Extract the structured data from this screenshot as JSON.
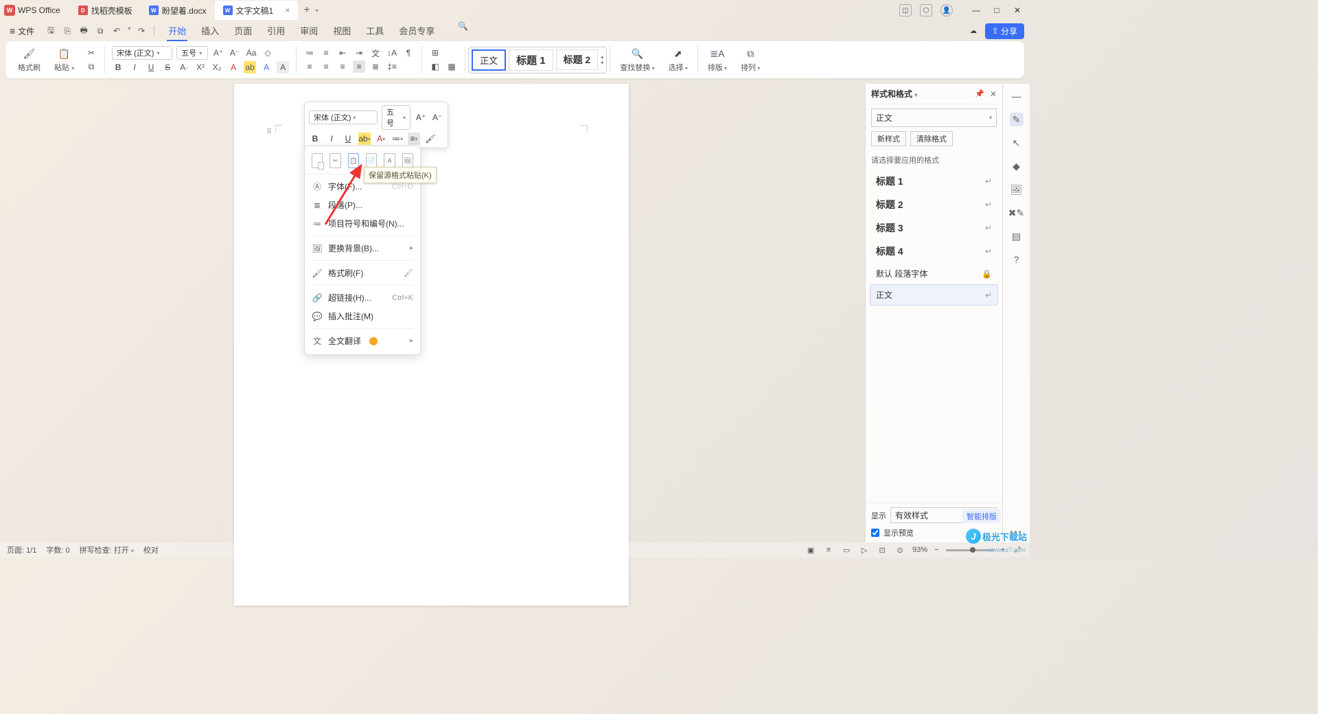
{
  "app": {
    "name": "WPS Office"
  },
  "tabs": [
    {
      "label": "找稻壳模板"
    },
    {
      "label": "盼望着.docx"
    },
    {
      "label": "文字文稿1",
      "active": true
    }
  ],
  "file_menu": {
    "label": "文件"
  },
  "menu": {
    "items": [
      "开始",
      "插入",
      "页面",
      "引用",
      "审阅",
      "视图",
      "工具",
      "会员专享"
    ],
    "active": "开始"
  },
  "share": {
    "label": "分享"
  },
  "ribbon": {
    "format_painter": "格式刷",
    "paste": "粘贴",
    "font_name": "宋体 (正文)",
    "font_size": "五号",
    "styles": {
      "normal": "正文",
      "h1": "标题 1",
      "h2": "标题 2"
    },
    "find_replace": "查找替换",
    "select": "选择",
    "layout": "排版",
    "arrange": "排列"
  },
  "mini_toolbar": {
    "font_name": "宋体 (正文)",
    "font_size": "五号"
  },
  "context_menu": {
    "tooltip": "保留源格式粘贴(K)",
    "font": "字体(F)...",
    "paragraph": "段落(P)...",
    "bullets": "项目符号和编号(N)...",
    "background": "更换背景(B)...",
    "painter": "格式刷(F)",
    "hyperlink": "超链接(H)...",
    "hyperlink_short": "Ctrl+K",
    "comment": "插入批注(M)",
    "translate": "全文翻译",
    "ctrl_d": "Ctrl+D"
  },
  "right_panel": {
    "title": "样式和格式",
    "current": "正文",
    "new_style": "新样式",
    "clear_format": "清除格式",
    "prompt": "请选择要应用的格式",
    "items": [
      {
        "label": "标题 1"
      },
      {
        "label": "标题 2"
      },
      {
        "label": "标题 3"
      },
      {
        "label": "标题 4"
      },
      {
        "label": "默认 段落字体",
        "normal": true,
        "lock": true
      },
      {
        "label": "正文",
        "normal": true,
        "selected": true
      }
    ],
    "show_label": "显示",
    "show_value": "有效样式",
    "preview": "显示预览",
    "smart": "智能排版"
  },
  "status": {
    "page": "页面: 1/1",
    "words": "字数: 0",
    "spell": "拼写检查: 打开",
    "proof": "校对",
    "zoom": "93%"
  },
  "watermark": {
    "text": "极光下载站",
    "url": "www.xz7.com"
  }
}
